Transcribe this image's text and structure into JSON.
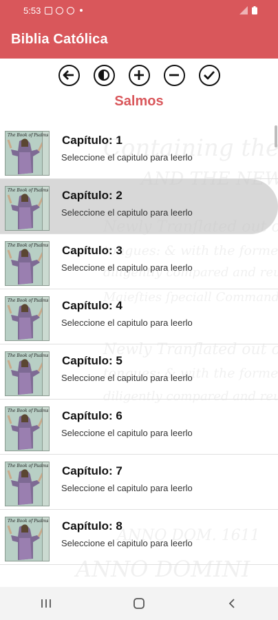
{
  "status_bar": {
    "time": "5:53"
  },
  "app_bar": {
    "title": "Biblia Católica"
  },
  "toolbar": {
    "buttons": [
      "back-icon",
      "contrast-icon",
      "zoom-in-icon",
      "zoom-out-icon",
      "check-icon"
    ]
  },
  "section": {
    "title": "Salmos"
  },
  "background_text": [
    "Containing the Old Teftament",
    "AND THE NEW:",
    "Newly Tranſlated out of the Originall",
    "tongues: & with the former Tranſlations",
    "diligently compared and reuiſed, by his",
    "Maieſties ſpeciall Commandement.",
    "Newly Tranſlated out of the Originall",
    "tongues: & with the former Tranſlations",
    "diligently compared and reuiſed, by his",
    "ANNO DOM. 1611",
    "ANNO DOMINI"
  ],
  "chapters": [
    {
      "title": "Capítulo: 1",
      "subtitle": "Seleccione el capitulo para leerlo"
    },
    {
      "title": "Capítulo: 2",
      "subtitle": "Seleccione el capitulo para leerlo"
    },
    {
      "title": "Capítulo: 3",
      "subtitle": "Seleccione el capitulo para leerlo"
    },
    {
      "title": "Capítulo: 4",
      "subtitle": "Seleccione el capitulo para leerlo"
    },
    {
      "title": "Capítulo: 5",
      "subtitle": "Seleccione el capitulo para leerlo"
    },
    {
      "title": "Capítulo: 6",
      "subtitle": "Seleccione el capitulo para leerlo"
    },
    {
      "title": "Capítulo: 7",
      "subtitle": "Seleccione el capitulo para leerlo"
    },
    {
      "title": "Capítulo: 8",
      "subtitle": "Seleccione el capitulo para leerlo"
    }
  ],
  "thumbnail": {
    "caption": "The Book of Psalms"
  },
  "colors": {
    "accent": "#d9575b",
    "highlight_row": "#c3c3c3"
  },
  "nav_bar": {
    "buttons": [
      "recent-apps-icon",
      "home-icon",
      "back-nav-icon"
    ]
  }
}
